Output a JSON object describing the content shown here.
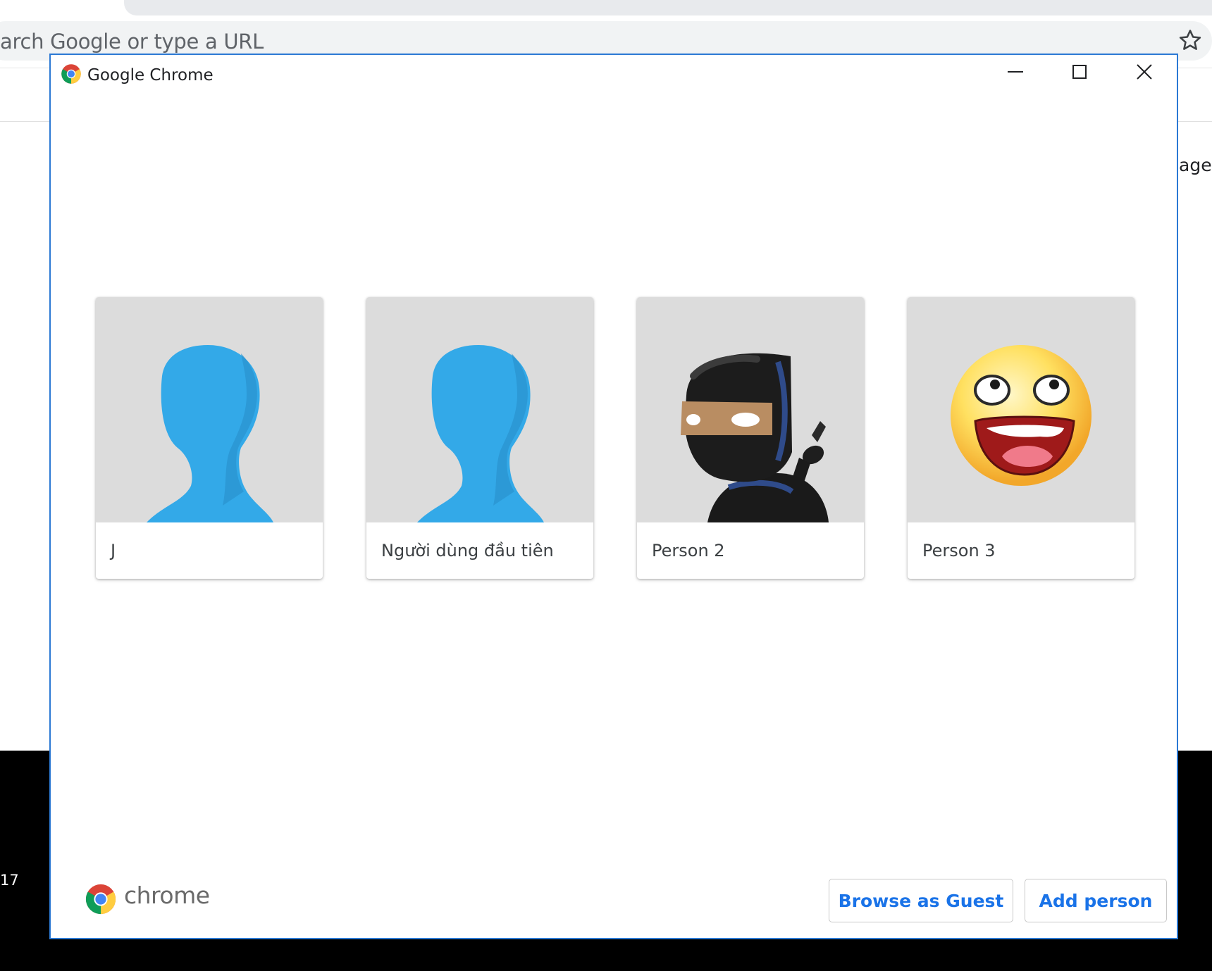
{
  "background_browser": {
    "omnibox_text": "arch Google or type a URL",
    "side_text": "age",
    "taskbar_clock": "17"
  },
  "window": {
    "title": "Google Chrome",
    "controls": {
      "minimize_icon": "minimize-icon",
      "maximize_icon": "maximize-icon",
      "close_icon": "close-icon"
    }
  },
  "profiles": [
    {
      "name": "J",
      "avatar": "generic-blue-person-avatar"
    },
    {
      "name": "Người dùng đầu tiên",
      "avatar": "generic-blue-person-avatar"
    },
    {
      "name": "Person 2",
      "avatar": "ninja-avatar"
    },
    {
      "name": "Person 3",
      "avatar": "smiley-avatar"
    }
  ],
  "footer": {
    "brand": "chrome",
    "browse_as_guest": "Browse as Guest",
    "add_person": "Add person"
  },
  "colors": {
    "accent": "#1a73e8",
    "window_border": "#2b79d4",
    "avatar_blue": "#33a9e8",
    "card_image_bg": "#dcdcdc"
  }
}
